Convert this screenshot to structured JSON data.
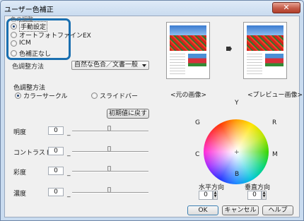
{
  "window": {
    "title": "ユーザー色補正",
    "close_glyph": "✕"
  },
  "mode": {
    "options": [
      "手動設定",
      "オートフォトファインEX",
      "ICM",
      "色補正なし"
    ],
    "selected_index": 0
  },
  "color_mode": {
    "label": "色調整方法",
    "value": "自然な色合／文書一般"
  },
  "adjust_method": {
    "group_label": "色調整方法",
    "options": [
      "カラーサークル",
      "スライドバー"
    ],
    "selected_index": 0
  },
  "reset_button": "初期値に戻す",
  "sliders": [
    {
      "label": "明度",
      "value": "0"
    },
    {
      "label": "コントラスト",
      "value": "0"
    },
    {
      "label": "彩度",
      "value": "0"
    },
    {
      "label": "濃度",
      "value": "0"
    }
  ],
  "previews": {
    "original_label": "<元の画像>",
    "preview_label": "<プレビュー画像>"
  },
  "wheel_labels": {
    "Y": "Y",
    "G": "G",
    "R": "R",
    "C": "C",
    "M": "M",
    "B": "B"
  },
  "horizontal": {
    "label": "水平方向",
    "value": "0"
  },
  "vertical": {
    "label": "垂直方向",
    "value": "0"
  },
  "buttons": {
    "ok": "OK",
    "cancel": "キャンセル",
    "help": "ヘルプ"
  }
}
